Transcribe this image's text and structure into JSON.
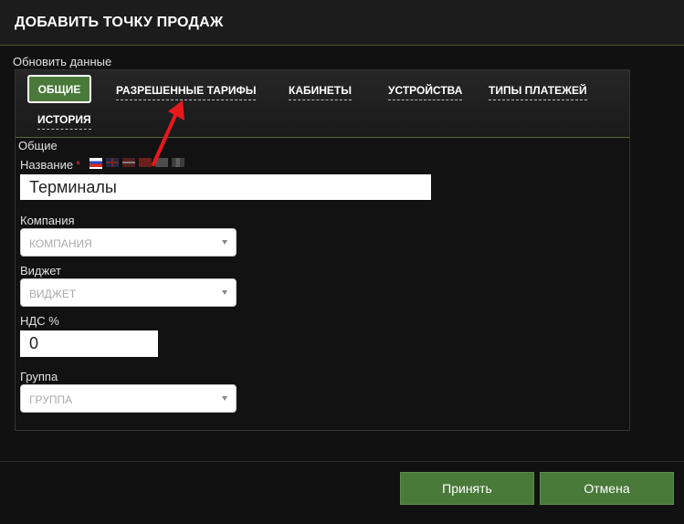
{
  "header": {
    "title": "ДОБАВИТЬ ТОЧКУ ПРОДАЖ"
  },
  "refresh_link": "Обновить данные",
  "tabs": [
    {
      "label": "ОБЩИЕ",
      "active": true
    },
    {
      "label": "РАЗРЕШЕННЫЕ ТАРИФЫ"
    },
    {
      "label": "КАБИНЕТЫ"
    },
    {
      "label": "УСТРОЙСТВА"
    },
    {
      "label": "ТИПЫ ПЛАТЕЖЕЙ"
    },
    {
      "label": "ИСТОРИЯ"
    }
  ],
  "form": {
    "section_title": "Общие",
    "name_label": "Название",
    "required_mark": "*",
    "name_value": "Терминалы",
    "company_label": "Компания",
    "company_placeholder": "КОМПАНИЯ",
    "widget_label": "Виджет",
    "widget_placeholder": "ВИДЖЕТ",
    "vat_label": "НДС %",
    "vat_value": "0",
    "group_label": "Группа",
    "group_placeholder": "ГРУППА"
  },
  "footer": {
    "accept_label": "Принять",
    "cancel_label": "Отмена"
  },
  "colors": {
    "accent": "#4a7a3a",
    "annotation_arrow": "#e8191b",
    "required": "#e03030"
  },
  "icons": [
    "flag-ru-icon",
    "flag-gb-icon",
    "flag-lv-icon",
    "flag-cn-icon",
    "flag-icon",
    "flag-icon",
    "chevron-down-icon",
    "annotation-arrow-icon"
  ]
}
